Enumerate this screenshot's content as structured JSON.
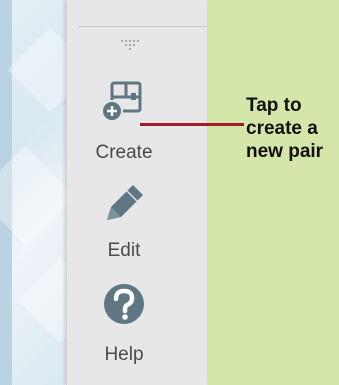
{
  "toolbar": {
    "create_label": "Create",
    "edit_label": "Edit",
    "help_label": "Help"
  },
  "callout": {
    "lines": [
      "Tap to",
      "create a",
      "new pair"
    ],
    "line_color": "#9f1d2a"
  },
  "colors": {
    "page_background": "#d5e6a9",
    "panel": "#e7e7e7",
    "icon": "#5f7782",
    "label": "#4a4a4a"
  },
  "icons": {
    "create": "create-pair-icon",
    "edit": "pencil-icon",
    "help": "question-mark-icon",
    "handle": "drag-handle-icon"
  }
}
